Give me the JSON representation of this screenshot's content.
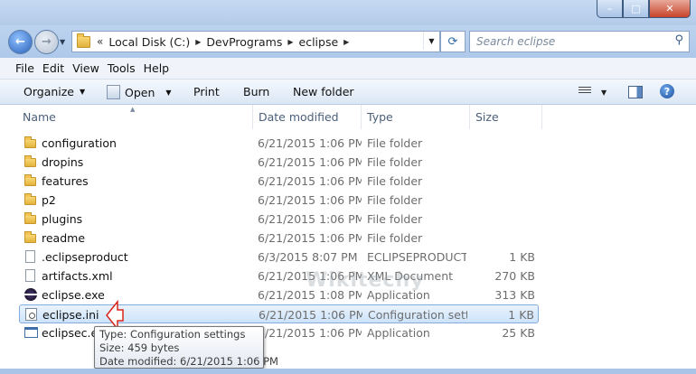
{
  "window": {
    "controls": {
      "minimize": "–",
      "maximize": "□",
      "close": "✕"
    }
  },
  "address": {
    "overflow": "«",
    "crumbs": [
      "Local Disk (C:)",
      "DevPrograms",
      "eclipse"
    ],
    "search_placeholder": "Search eclipse"
  },
  "menu": [
    "File",
    "Edit",
    "View",
    "Tools",
    "Help"
  ],
  "commands": {
    "organize": "Organize",
    "open": "Open",
    "print": "Print",
    "burn": "Burn",
    "new_folder": "New folder"
  },
  "columns": {
    "name": "Name",
    "date": "Date modified",
    "type": "Type",
    "size": "Size"
  },
  "files": [
    {
      "name": "configuration",
      "date": "6/21/2015 1:06 PM",
      "type": "File folder",
      "size": "",
      "icon": "folder-icon"
    },
    {
      "name": "dropins",
      "date": "6/21/2015 1:06 PM",
      "type": "File folder",
      "size": "",
      "icon": "folder-icon"
    },
    {
      "name": "features",
      "date": "6/21/2015 1:06 PM",
      "type": "File folder",
      "size": "",
      "icon": "folder-icon"
    },
    {
      "name": "p2",
      "date": "6/21/2015 1:06 PM",
      "type": "File folder",
      "size": "",
      "icon": "folder-icon"
    },
    {
      "name": "plugins",
      "date": "6/21/2015 1:06 PM",
      "type": "File folder",
      "size": "",
      "icon": "folder-icon"
    },
    {
      "name": "readme",
      "date": "6/21/2015 1:06 PM",
      "type": "File folder",
      "size": "",
      "icon": "folder-icon"
    },
    {
      "name": ".eclipseproduct",
      "date": "6/3/2015 8:07 PM",
      "type": "ECLIPSEPRODUCT...",
      "size": "1 KB",
      "icon": "document-icon"
    },
    {
      "name": "artifacts.xml",
      "date": "6/21/2015 1:06 PM",
      "type": "XML Document",
      "size": "270 KB",
      "icon": "document-icon"
    },
    {
      "name": "eclipse.exe",
      "date": "6/21/2015 1:08 PM",
      "type": "Application",
      "size": "313 KB",
      "icon": "eclipse-icon"
    },
    {
      "name": "eclipse.ini",
      "date": "6/21/2015 1:06 PM",
      "type": "Configuration sett...",
      "size": "1 KB",
      "icon": "settings-file-icon",
      "selected": true
    },
    {
      "name": "eclipsec.exe",
      "date": "6/21/2015 1:06 PM",
      "type": "Application",
      "size": "25 KB",
      "icon": "application-icon"
    }
  ],
  "tooltip": {
    "type": "Type: Configuration settings",
    "size": "Size: 459 bytes",
    "date": "Date modified: 6/21/2015 1:06 PM"
  },
  "watermark": "Wikitechy",
  "colors": {
    "selection": "#cde3fb",
    "selection_border": "#84acdd",
    "arrow": "#d9261c"
  }
}
